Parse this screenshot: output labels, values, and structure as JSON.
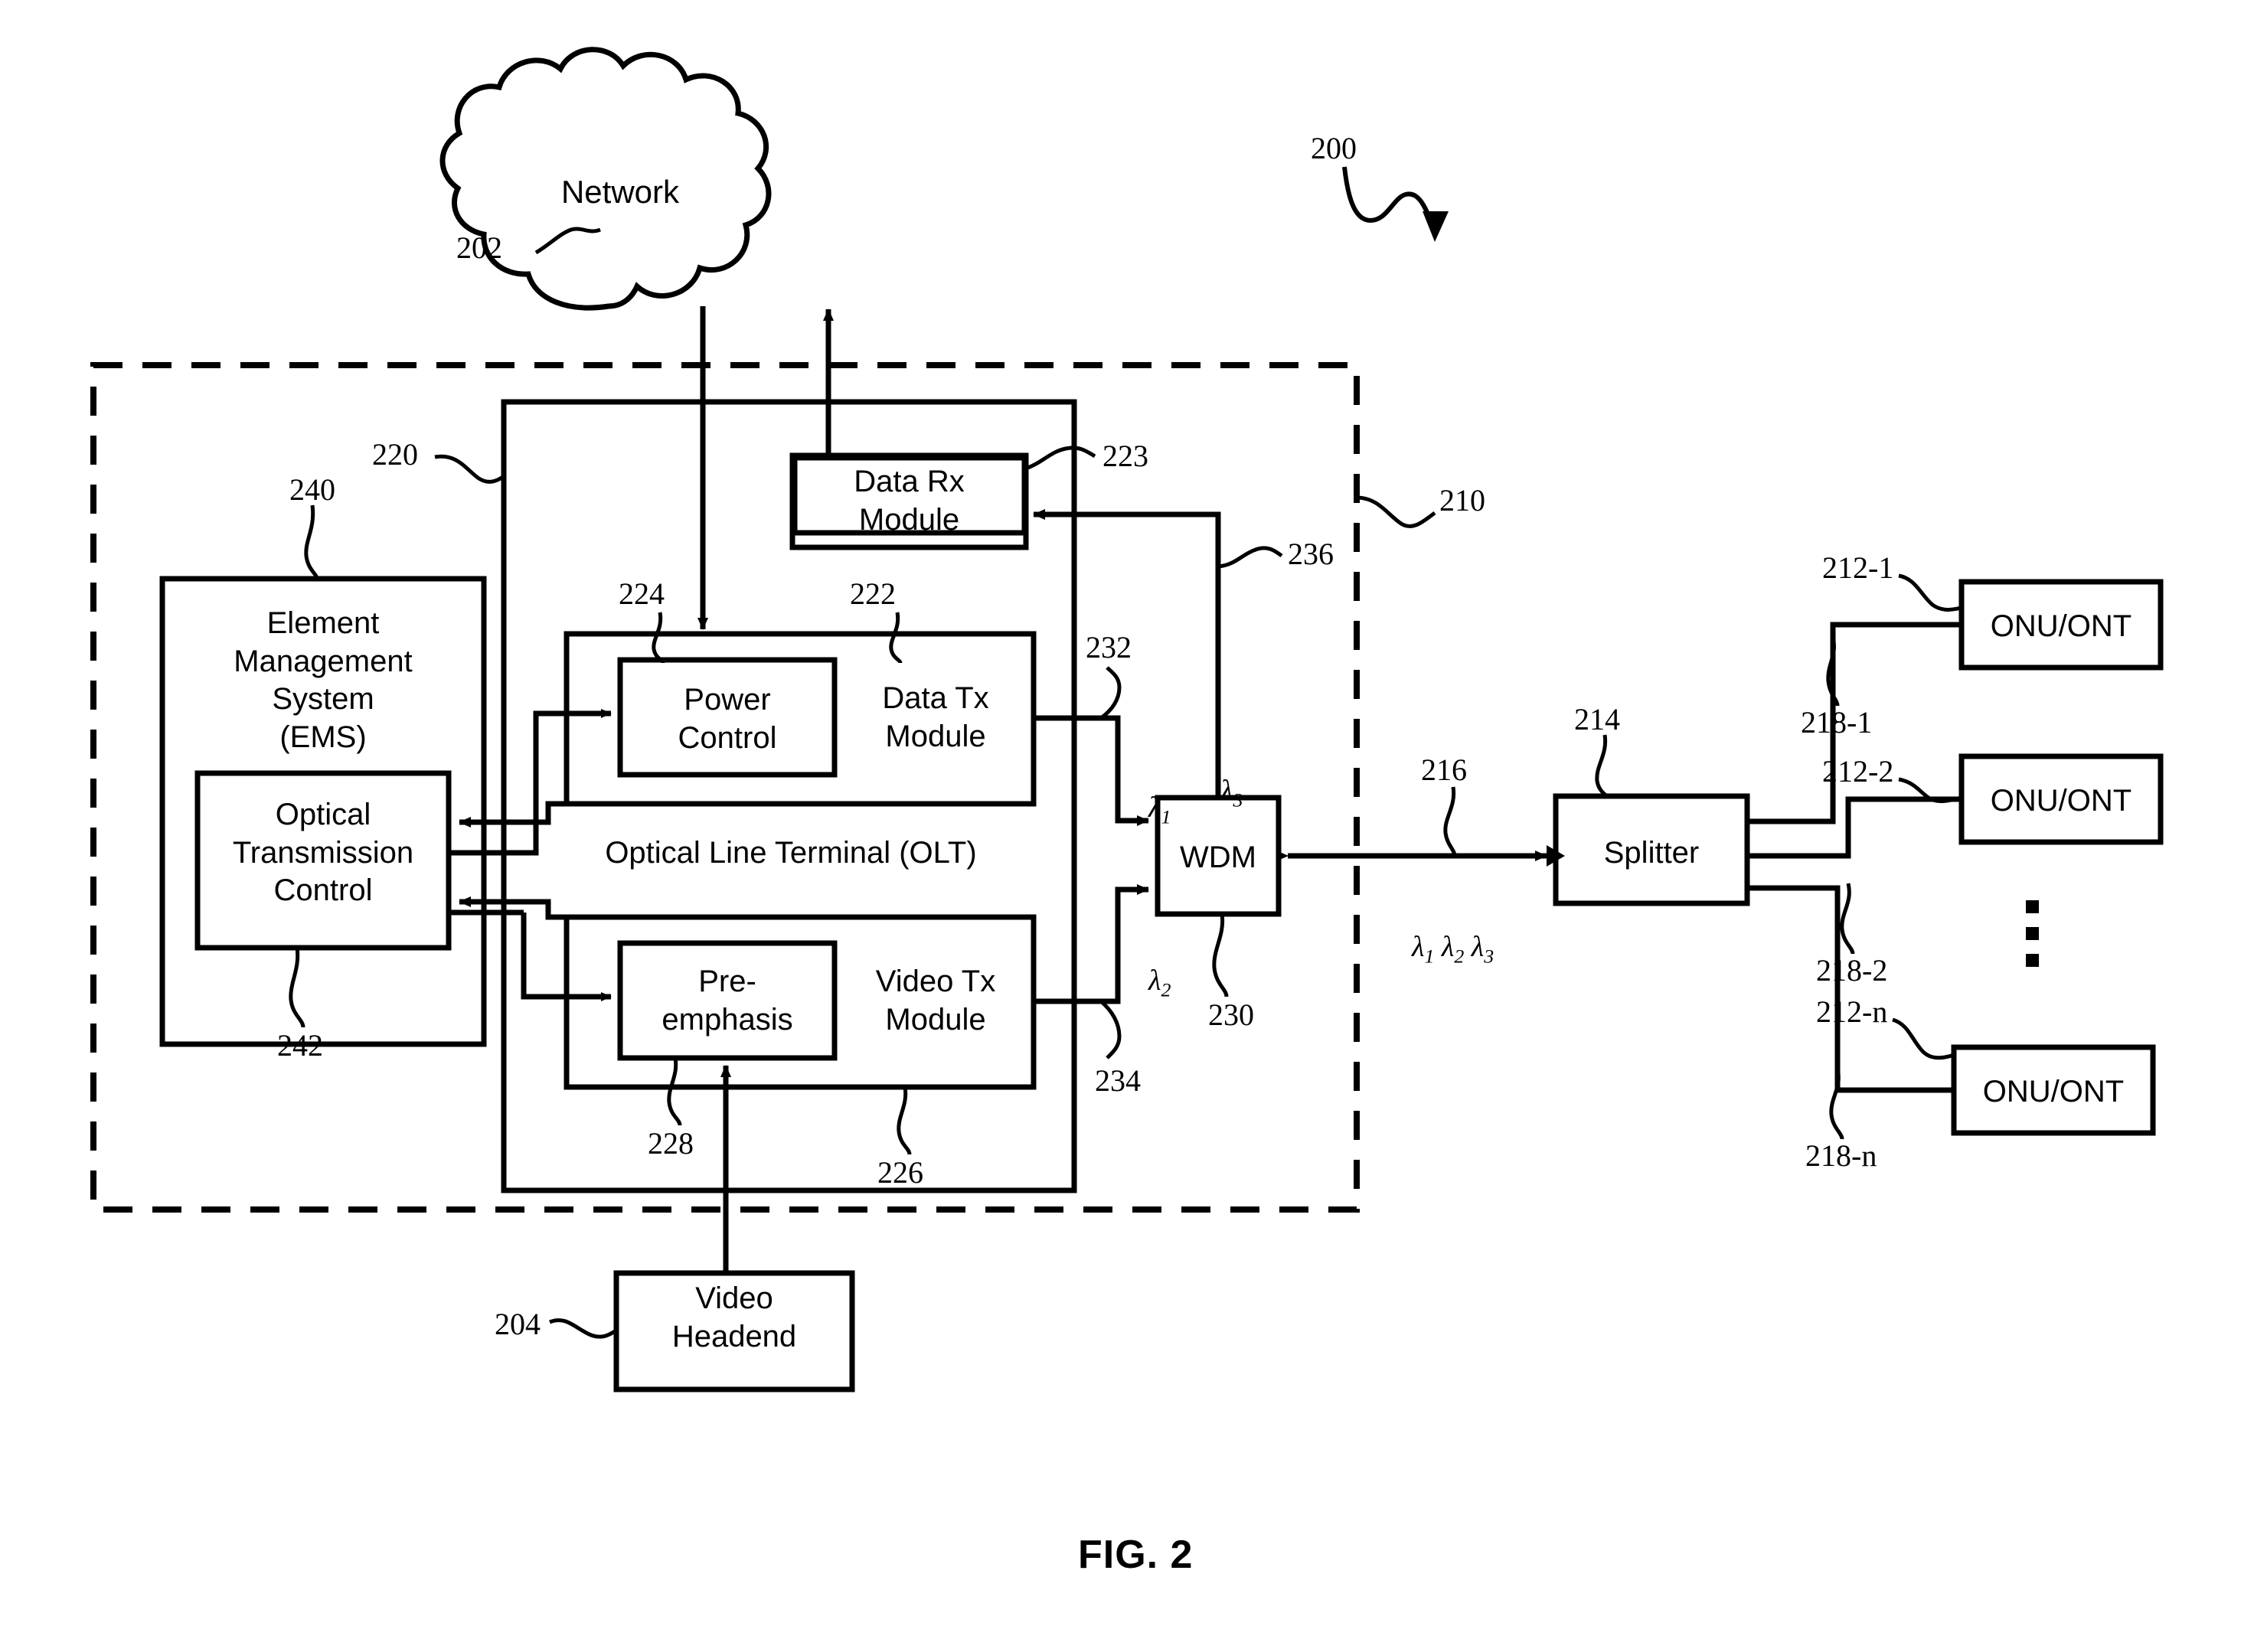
{
  "figure": {
    "caption": "FIG. 2",
    "system_ref": "200"
  },
  "nodes": {
    "network": {
      "label": "Network",
      "ref": "202"
    },
    "data_rx_module": {
      "label": "Data Rx\nModule",
      "ref": "223"
    },
    "data_tx_module": {
      "label": "Data Tx\nModule",
      "ref": "222"
    },
    "power_control": {
      "label": "Power\nControl",
      "ref": "224"
    },
    "video_tx_module": {
      "label": "Video Tx\nModule",
      "ref": "226"
    },
    "pre_emphasis": {
      "label": "Pre-\nemphasis",
      "ref": "228"
    },
    "olt": {
      "label": "Optical Line Terminal (OLT)",
      "ref": "220"
    },
    "ems": {
      "label": "Element\nManagement\nSystem\n(EMS)",
      "ref": "240"
    },
    "optical_transmission_control": {
      "label": "Optical\nTransmission\nControl",
      "ref": "242"
    },
    "wdm": {
      "label": "WDM",
      "ref": "230"
    },
    "splitter": {
      "label": "Splitter",
      "ref": "214"
    },
    "video_headend": {
      "label": "Video\nHeadend",
      "ref": "204"
    },
    "central_office": {
      "ref": "210"
    }
  },
  "onus": [
    {
      "label": "ONU/ONT",
      "ref": "212-1",
      "fiber_ref": "218-1"
    },
    {
      "label": "ONU/ONT",
      "ref": "212-2",
      "fiber_ref": "218-2"
    },
    {
      "label": "ONU/ONT",
      "ref": "212-n",
      "fiber_ref": "218-n"
    }
  ],
  "links": {
    "data_tx_out": {
      "ref": "232",
      "wavelength": "λ",
      "wavelength_sub": "1"
    },
    "video_tx_out": {
      "ref": "234",
      "wavelength": "λ",
      "wavelength_sub": "2"
    },
    "data_rx_in": {
      "ref": "236",
      "wavelength": "λ",
      "wavelength_sub": "3"
    },
    "feeder_fiber": {
      "ref": "216",
      "wavelengths": "λ1 λ2 λ3"
    }
  },
  "wavelength_labels": {
    "lambda1": "λ",
    "lambda2": "λ",
    "lambda3": "λ",
    "sub1": "1",
    "sub2": "2",
    "sub3": "3"
  },
  "dots": {
    "name": "vertical-ellipsis"
  },
  "colors": {
    "stroke": "#000000",
    "background": "#ffffff"
  }
}
